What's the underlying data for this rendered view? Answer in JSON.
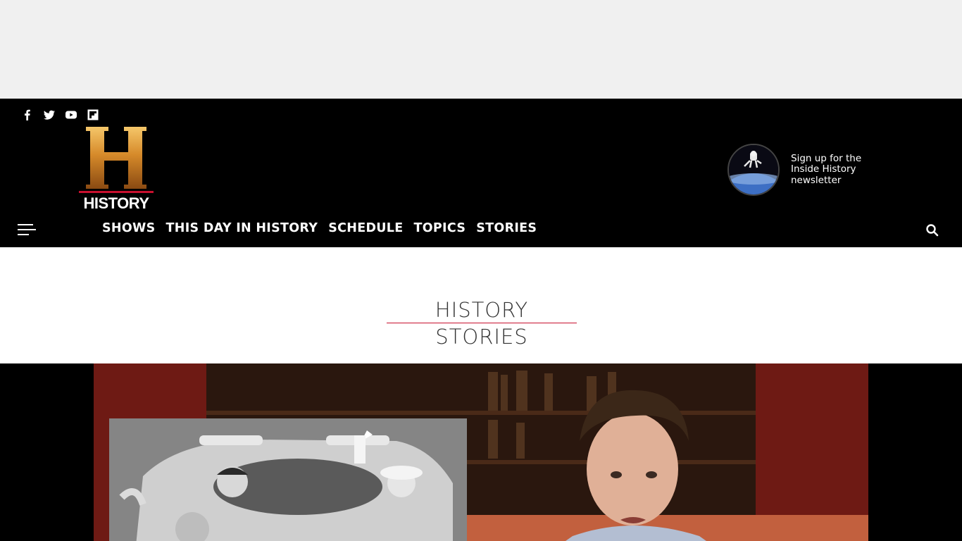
{
  "social": {
    "icons": [
      "facebook-icon",
      "twitter-icon",
      "youtube-icon",
      "flipboard-icon"
    ]
  },
  "logo": {
    "letter": "H",
    "word": "HISTORY",
    "tm": "."
  },
  "newsletter": {
    "text": "Sign up for the Inside History newsletter"
  },
  "nav": {
    "items": [
      "SHOWS",
      "THIS DAY IN HISTORY",
      "SCHEDULE",
      "TOPICS",
      "STORIES"
    ]
  },
  "page": {
    "heading": "HISTORY STORIES"
  },
  "colors": {
    "header_bg": "#000000",
    "ad_bg": "#f0f0f0",
    "accent_red": "#c8102e",
    "logo_gold": "#d68a2a"
  }
}
